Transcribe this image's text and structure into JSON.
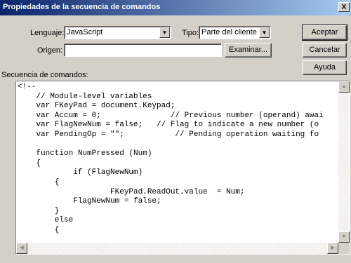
{
  "window": {
    "title": "Propiedades de la secuencia de comandos",
    "close_glyph": "X"
  },
  "form": {
    "language_label": "Lenguaje:",
    "language_value": "JavaScript",
    "type_label": "Tipo:",
    "type_value": "Parte del cliente",
    "source_label": "Origen:",
    "source_value": "",
    "browse_label": "Examinar...",
    "script_label": "Secuencia de comandos:"
  },
  "buttons": {
    "accept": "Aceptar",
    "cancel": "Cancelar",
    "help": "Ayuda"
  },
  "icons": {
    "combo_arrow": "chevron-down-icon",
    "scroll_up": "arrow-up-icon",
    "scroll_down": "arrow-down-icon",
    "scroll_left": "arrow-left-icon",
    "scroll_right": "arrow-right-icon"
  },
  "code": "<!--\n    // Module-level variables\n    var FKeyPad = document.Keypad;\n    var Accum = 0;               // Previous number (operand) awai\n    var FlagNewNum = false;   // Flag to indicate a new number (o\n    var PendingOp = \"\";           // Pending operation waiting fo\n\n    function NumPressed (Num)\n    {\n            if (FlagNewNum)\n        {\n                    FKeyPad.ReadOut.value  = Num;\n            FlagNewNum = false;\n        }\n        else\n        {"
}
